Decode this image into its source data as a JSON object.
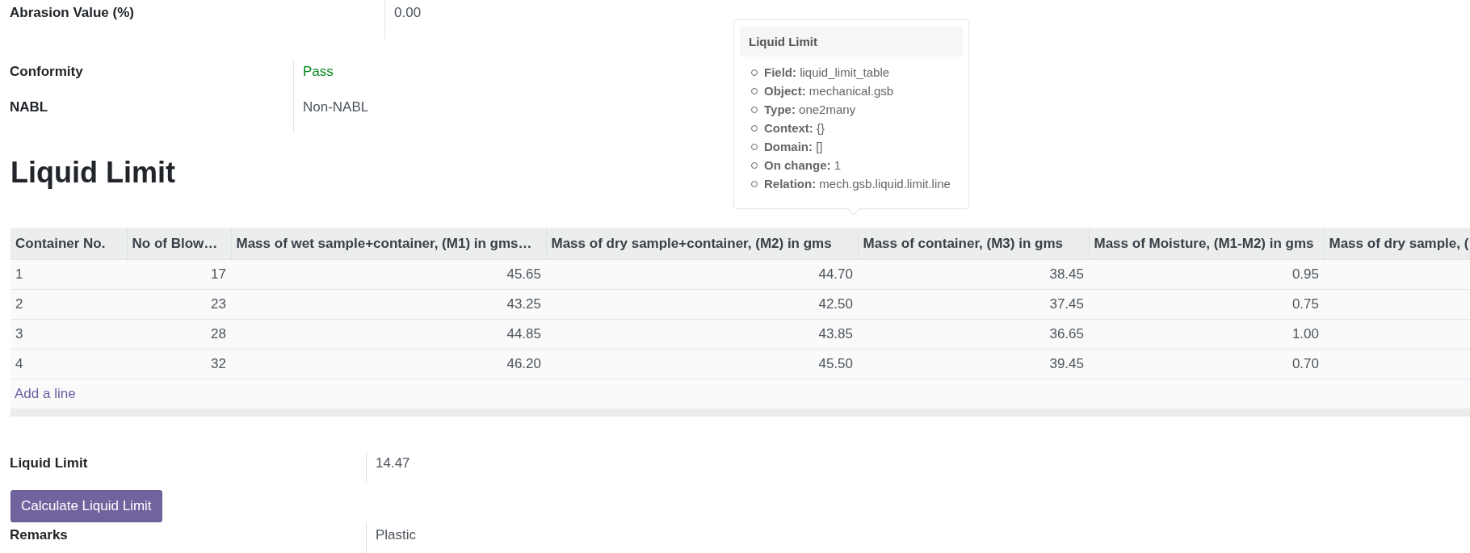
{
  "top_fields": [
    {
      "label": "Abrasion Value (%)",
      "value": "0.00"
    }
  ],
  "status_fields": [
    {
      "label": "Conformity",
      "value": "Pass",
      "kind": "success"
    },
    {
      "label": "NABL",
      "value": "Non-NABL",
      "kind": "plain"
    }
  ],
  "section_title": "Liquid Limit",
  "tooltip": {
    "title": "Liquid Limit",
    "items": [
      {
        "key": "Field:",
        "value": "liquid_limit_table"
      },
      {
        "key": "Object:",
        "value": "mechanical.gsb"
      },
      {
        "key": "Type:",
        "value": "one2many"
      },
      {
        "key": "Context:",
        "value": "{}"
      },
      {
        "key": "Domain:",
        "value": "[]"
      },
      {
        "key": "On change:",
        "value": "1"
      },
      {
        "key": "Relation:",
        "value": "mech.gsb.liquid.limit.line"
      }
    ]
  },
  "table": {
    "columns": [
      "Container No.",
      "No of Blow…",
      "Mass of wet sample+container, (M1) in gms…",
      "Mass of dry sample+container, (M2) in gms",
      "Mass of container, (M3) in gms",
      "Mass of Moisture, (M1-M2) in gms",
      "Mass of dry sample, ("
    ],
    "rows": [
      [
        "1",
        "17",
        "45.65",
        "44.70",
        "38.45",
        "0.95"
      ],
      [
        "2",
        "23",
        "43.25",
        "42.50",
        "37.45",
        "0.75"
      ],
      [
        "3",
        "28",
        "44.85",
        "43.85",
        "36.65",
        "1.00"
      ],
      [
        "4",
        "32",
        "46.20",
        "45.50",
        "39.45",
        "0.70"
      ]
    ],
    "add_line": "Add a line"
  },
  "result_field": {
    "label": "Liquid Limit",
    "value": "14.47"
  },
  "button": "Calculate Liquid Limit",
  "remarks_field": {
    "label": "Remarks",
    "value": "Plastic"
  }
}
